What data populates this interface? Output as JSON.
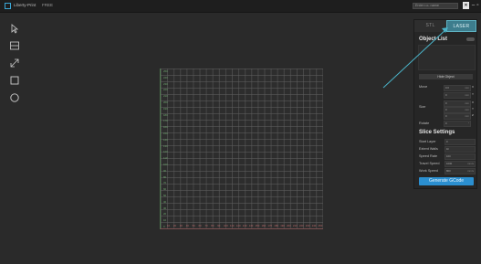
{
  "titlebar": {
    "app_title": "Liberty-Print",
    "file_name": "FREE",
    "login_placeholder": "Enter r.o. name",
    "close_label": "✕",
    "minimize_label": "–",
    "maximize_label": "▫"
  },
  "tools": [
    {
      "name": "select-tool",
      "icon": "cursor-icon"
    },
    {
      "name": "layers-tool",
      "icon": "layers-icon"
    },
    {
      "name": "scale-tool",
      "icon": "resize-icon"
    },
    {
      "name": "rectangle-tool",
      "icon": "square-icon"
    },
    {
      "name": "circle-tool",
      "icon": "circle-icon"
    }
  ],
  "plate": {
    "y_ticks": [
      "250",
      "240",
      "230",
      "220",
      "210",
      "200",
      "190",
      "180",
      "170",
      "160",
      "150",
      "140",
      "130",
      "120",
      "110",
      "100",
      "90",
      "80",
      "70",
      "60",
      "50",
      "40",
      "30",
      "20",
      "10",
      "0"
    ],
    "x_ticks": [
      "10",
      "20",
      "30",
      "40",
      "50",
      "60",
      "70",
      "80",
      "90",
      "100",
      "110",
      "120",
      "130",
      "140",
      "150",
      "160",
      "170",
      "180",
      "190",
      "200",
      "210",
      "220",
      "230",
      "240",
      "250"
    ],
    "grid_color": "#5f5f5f",
    "y_axis_color": "#6fa86f",
    "x_axis_color": "#b86a6a"
  },
  "panel": {
    "tabs": [
      "STL",
      "LASER"
    ],
    "object_list_title": "Object List",
    "hide_object_label": "Hide Object",
    "move_label": "Move",
    "size_label": "Size",
    "rotate_label": "Rotate",
    "move": [
      {
        "value": "0.0",
        "unit": "mm",
        "axis": "X"
      },
      {
        "value": "0",
        "unit": "mm",
        "axis": "Y"
      }
    ],
    "size": [
      {
        "value": "0",
        "unit": "mm",
        "axis": "X"
      },
      {
        "value": "0",
        "unit": "mm",
        "axis": "Y"
      },
      {
        "value": "0",
        "unit": "mm",
        "axis": "Z"
      }
    ],
    "rotate": {
      "value": "0",
      "unit": "°"
    },
    "slice_settings_title": "Slice Settings",
    "settings": [
      {
        "label": "Start Layer",
        "value": "0",
        "unit": ""
      },
      {
        "label": "Extent Walls",
        "value": "1h",
        "unit": ""
      },
      {
        "label": "Speed Rate",
        "value": "100",
        "unit": ""
      },
      {
        "label": "Travel Speed",
        "value": "1000",
        "unit": "mm/s"
      },
      {
        "label": "Work Speed",
        "value": "800",
        "unit": "mm/s"
      }
    ],
    "generate_label": "Generate GCode",
    "accent_color": "#2b8fd0",
    "laser_tab_color": "#3d7d8d"
  }
}
